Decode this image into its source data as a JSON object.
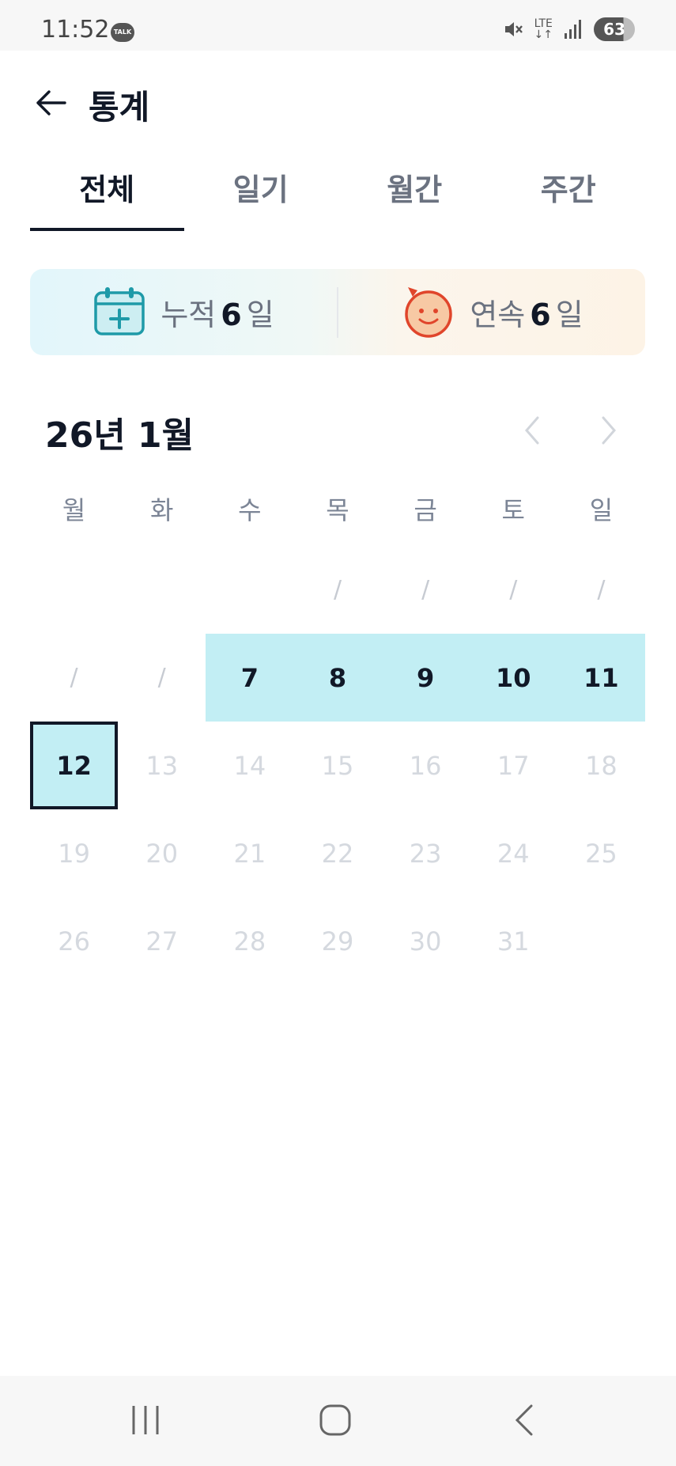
{
  "status_bar": {
    "time": "11:52",
    "talk_badge": "TALK",
    "network": "LTE",
    "battery": "63"
  },
  "header": {
    "title": "통계"
  },
  "tabs": [
    {
      "label": "전체",
      "active": true
    },
    {
      "label": "일기",
      "active": false
    },
    {
      "label": "월간",
      "active": false
    },
    {
      "label": "주간",
      "active": false
    }
  ],
  "streak": {
    "total_label": "누적",
    "total_value": "6",
    "total_unit": "일",
    "consecutive_label": "연속",
    "consecutive_value": "6",
    "consecutive_unit": "일"
  },
  "calendar": {
    "month_title": "26년 1월",
    "weekdays": [
      "월",
      "화",
      "수",
      "목",
      "금",
      "토",
      "일"
    ],
    "weeks": [
      [
        "",
        "",
        "",
        "/",
        "/",
        "/",
        "/"
      ],
      [
        "/",
        "/",
        "7",
        "8",
        "9",
        "10",
        "11"
      ],
      [
        "12",
        "13",
        "14",
        "15",
        "16",
        "17",
        "18"
      ],
      [
        "19",
        "20",
        "21",
        "22",
        "23",
        "24",
        "25"
      ],
      [
        "26",
        "27",
        "28",
        "29",
        "30",
        "31",
        ""
      ]
    ],
    "completed_days": [
      "7",
      "8",
      "9",
      "10",
      "11"
    ],
    "today": "12"
  },
  "colors": {
    "accent": "#c2eef4",
    "text_dark": "#111827",
    "muted": "#6b7280"
  }
}
